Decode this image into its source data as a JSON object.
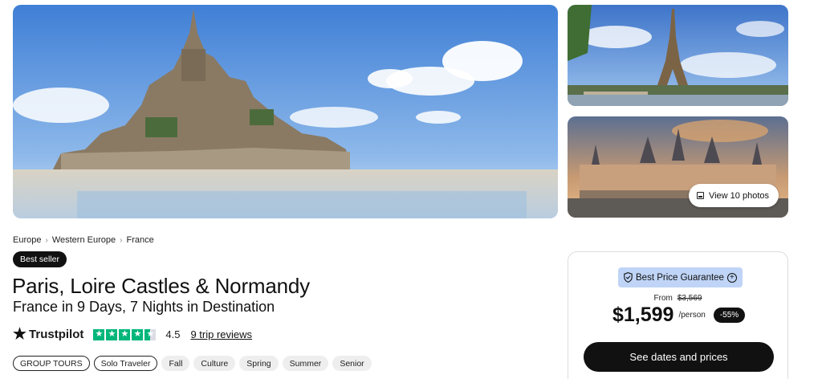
{
  "gallery": {
    "view_photos_label": "View 10 photos"
  },
  "breadcrumb": [
    "Europe",
    "Western Europe",
    "France"
  ],
  "badge": "Best seller",
  "tour": {
    "title": "Paris, Loire Castles & Normandy",
    "subtitle": "France in 9 Days, 7 Nights in Destination"
  },
  "rating": {
    "provider": "Trustpilot",
    "score": "4.5",
    "stars": 4.5,
    "reviews_label": "9 trip reviews"
  },
  "tags": [
    {
      "label": "GROUP TOURS",
      "style": "outline"
    },
    {
      "label": "Solo Traveler",
      "style": "outline"
    },
    {
      "label": "Fall",
      "style": "filled"
    },
    {
      "label": "Culture",
      "style": "filled"
    },
    {
      "label": "Spring",
      "style": "filled"
    },
    {
      "label": "Summer",
      "style": "filled"
    },
    {
      "label": "Senior",
      "style": "filled"
    }
  ],
  "pricing": {
    "guarantee_label": "Best Price Guarantee",
    "from_label": "From",
    "old_price": "$3,569",
    "price": "$1,599",
    "per_label": "/person",
    "discount": "-55%",
    "cta_label": "See dates and prices"
  },
  "colors": {
    "accent_dark": "#111111",
    "trustpilot_green": "#00b67a",
    "guarantee_bg": "#bfd4f6"
  }
}
